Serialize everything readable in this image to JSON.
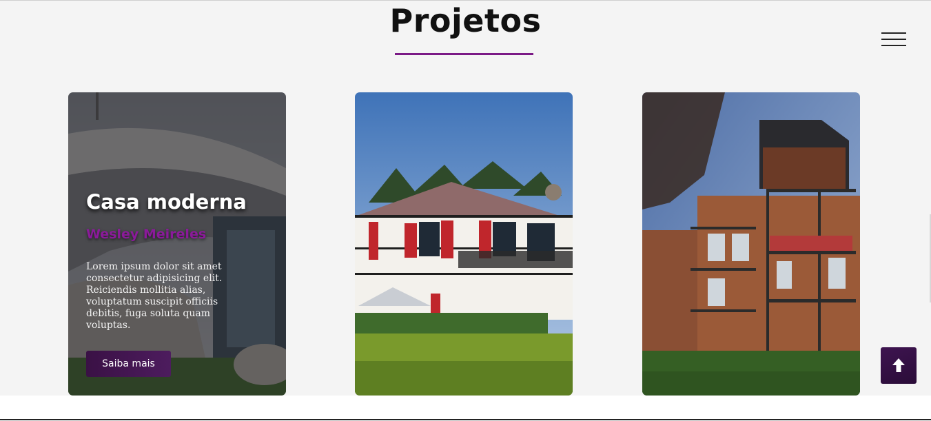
{
  "section": {
    "title": "Projetos"
  },
  "colors": {
    "accent": "#7b1a86",
    "button": "#3a1145",
    "background": "#f4f4f4"
  },
  "cards": [
    {
      "title": "Casa moderna",
      "author": "Wesley Meireles",
      "text": "Lorem ipsum dolor sit amet consectetur adipisicing elit. Reiciendis mollitia alias, voluptatum suscipit officiis debitis, fuga soluta quam voluptas.",
      "button_label": "Saiba mais",
      "image": "modern-building-photo"
    },
    {
      "image": "white-house-red-shutters-photo"
    },
    {
      "image": "brick-apartment-balconies-photo"
    }
  ],
  "icons": {
    "menu": "hamburger-menu-icon",
    "scroll_top": "arrow-up-icon"
  }
}
